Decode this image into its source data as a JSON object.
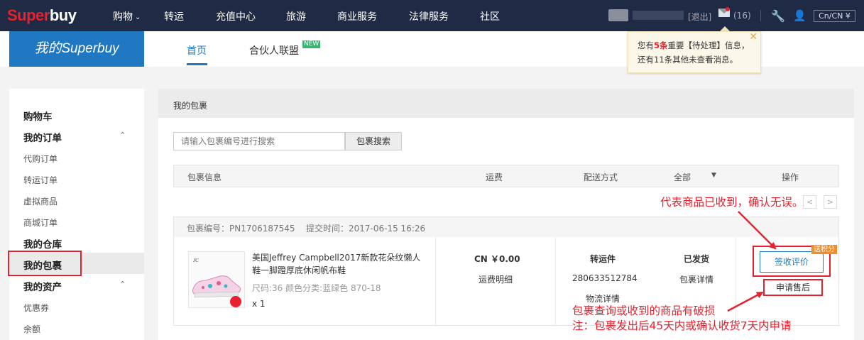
{
  "colors": {
    "accent": "#1f78c1",
    "brand_red": "#e8212e",
    "nav_bg": "#1f2a44",
    "annotation": "#e8212e"
  },
  "topnav": {
    "logo_part1": "Super",
    "logo_part2": "buy",
    "items": [
      "购物",
      "转运",
      "充值中心",
      "旅游",
      "商业服务",
      "法律服务",
      "社区"
    ],
    "logout": "[退出]",
    "mail_count": "(16)",
    "icons": [
      "mail-icon",
      "wrench-icon",
      "user-icon"
    ],
    "currency": "Cn/CN ¥"
  },
  "subheader": {
    "brand": "我的Superbuy",
    "tabs": [
      "首页",
      "合伙人联盟"
    ],
    "new_badge": "NEW"
  },
  "popup": {
    "line1_a": "您有",
    "line1_count": "5条",
    "line1_b": "重要【待处理】信息，",
    "line2": "还有11条其他未查看消息。",
    "close": "✕"
  },
  "sidebar": {
    "sections": [
      {
        "label": "购物车"
      },
      {
        "label": "我的订单",
        "items": [
          "代购订单",
          "转运订单",
          "虚拟商品",
          "商城订单"
        ]
      },
      {
        "label": "我的仓库"
      },
      {
        "label": "我的包裹"
      },
      {
        "label": "我的资产",
        "items": [
          "优惠券",
          "余额"
        ]
      }
    ],
    "caret_up": "⌃"
  },
  "main": {
    "title": "我的包裹",
    "search_placeholder": "请输入包裹编号进行搜索",
    "search_button": "包裹搜索",
    "columns": [
      "包裹信息",
      "运费",
      "配送方式",
      "全部",
      "操作"
    ],
    "pager_prev": "<",
    "pager_next": ">",
    "order": {
      "package_no": "包裹编号：PN1706187545",
      "submit_time": "提交时间：2017-06-15 16:26",
      "product_title": "美国Jeffrey Campbell2017新款花朵纹懒人鞋一脚蹬厚底休闲帆布鞋",
      "product_spec": "尺码:36 颜色分类:蓝绿色 870-18",
      "quantity": "x 1",
      "price": "CN ￥0.00",
      "price_link": "运费明细",
      "shipping_method": "转运件",
      "tracking_no": "280633512784",
      "tracking_link": "物流详情",
      "status": "已发货",
      "status_link": "包裹详情",
      "sign_button": "签收评价",
      "points_tag": "送积分",
      "after_sale_button": "申请售后"
    }
  },
  "annotations": {
    "note1": "代表商品已收到，确认无误。",
    "note2_line1": "包裹查询或收到的商品有破损",
    "note2_line2": "注：包裹发出后45天内或确认收货7天内申请"
  }
}
